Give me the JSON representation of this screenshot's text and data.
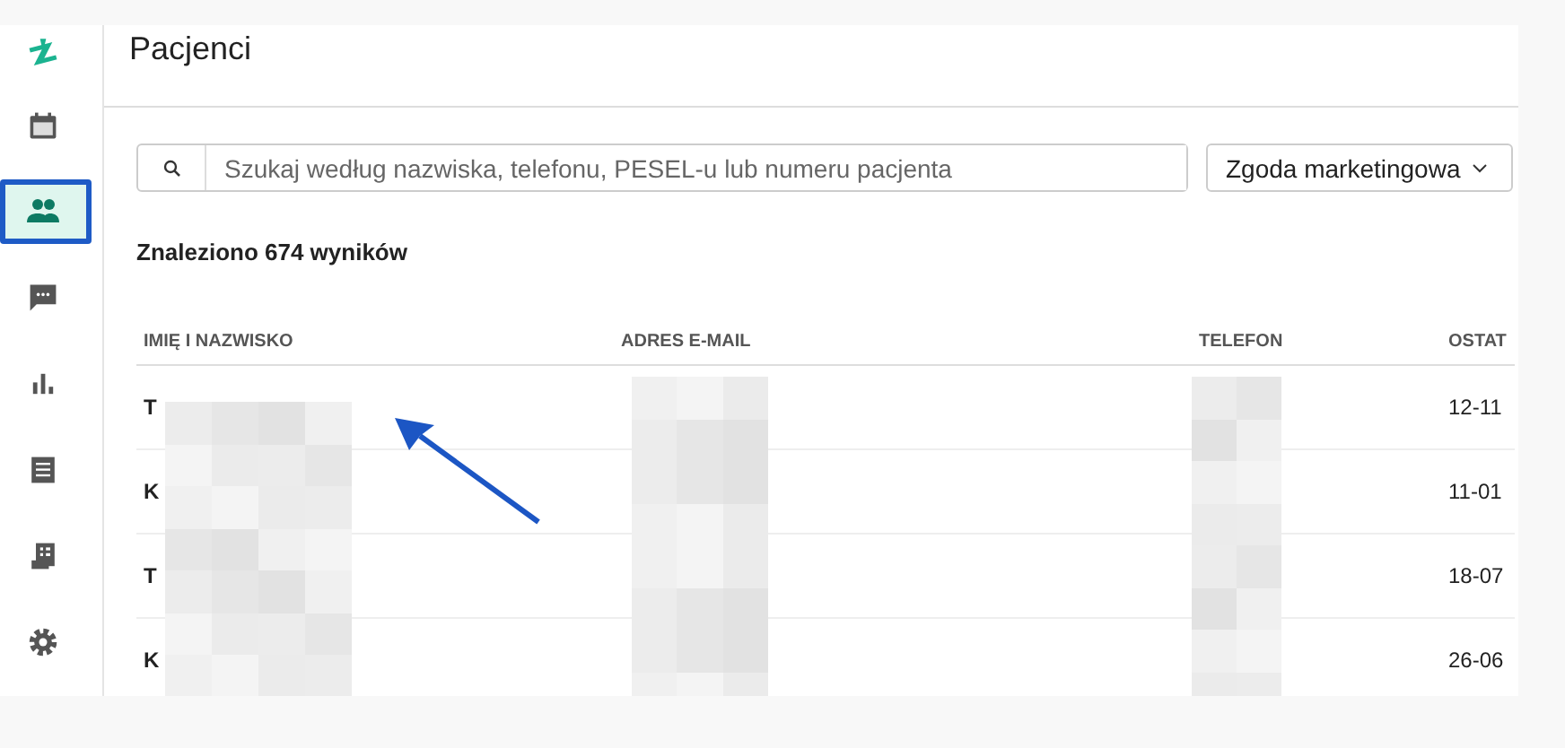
{
  "sidebar": {
    "items": [
      {
        "selected": false
      },
      {
        "selected": true
      },
      {
        "selected": false
      },
      {
        "selected": false
      },
      {
        "selected": false
      },
      {
        "selected": false
      },
      {
        "selected": false
      }
    ]
  },
  "header": {
    "title": "Pacjenci"
  },
  "search": {
    "placeholder": "Szukaj według nazwiska, telefonu, PESEL-u lub numeru pacjenta"
  },
  "filter": {
    "label": "Zgoda marketingowa"
  },
  "results": "Znaleziono 674 wyników",
  "table": {
    "columns": [
      "IMIĘ I NAZWISKO",
      "ADRES E-MAIL",
      "TELEFON",
      "OSTAT"
    ],
    "rows": [
      {
        "name": "T",
        "column_4": "12-11"
      },
      {
        "name": "K",
        "column_4": "11-01"
      },
      {
        "name": "T",
        "column_4": "18-07"
      },
      {
        "name": "K",
        "column_4": "26-06"
      }
    ]
  }
}
